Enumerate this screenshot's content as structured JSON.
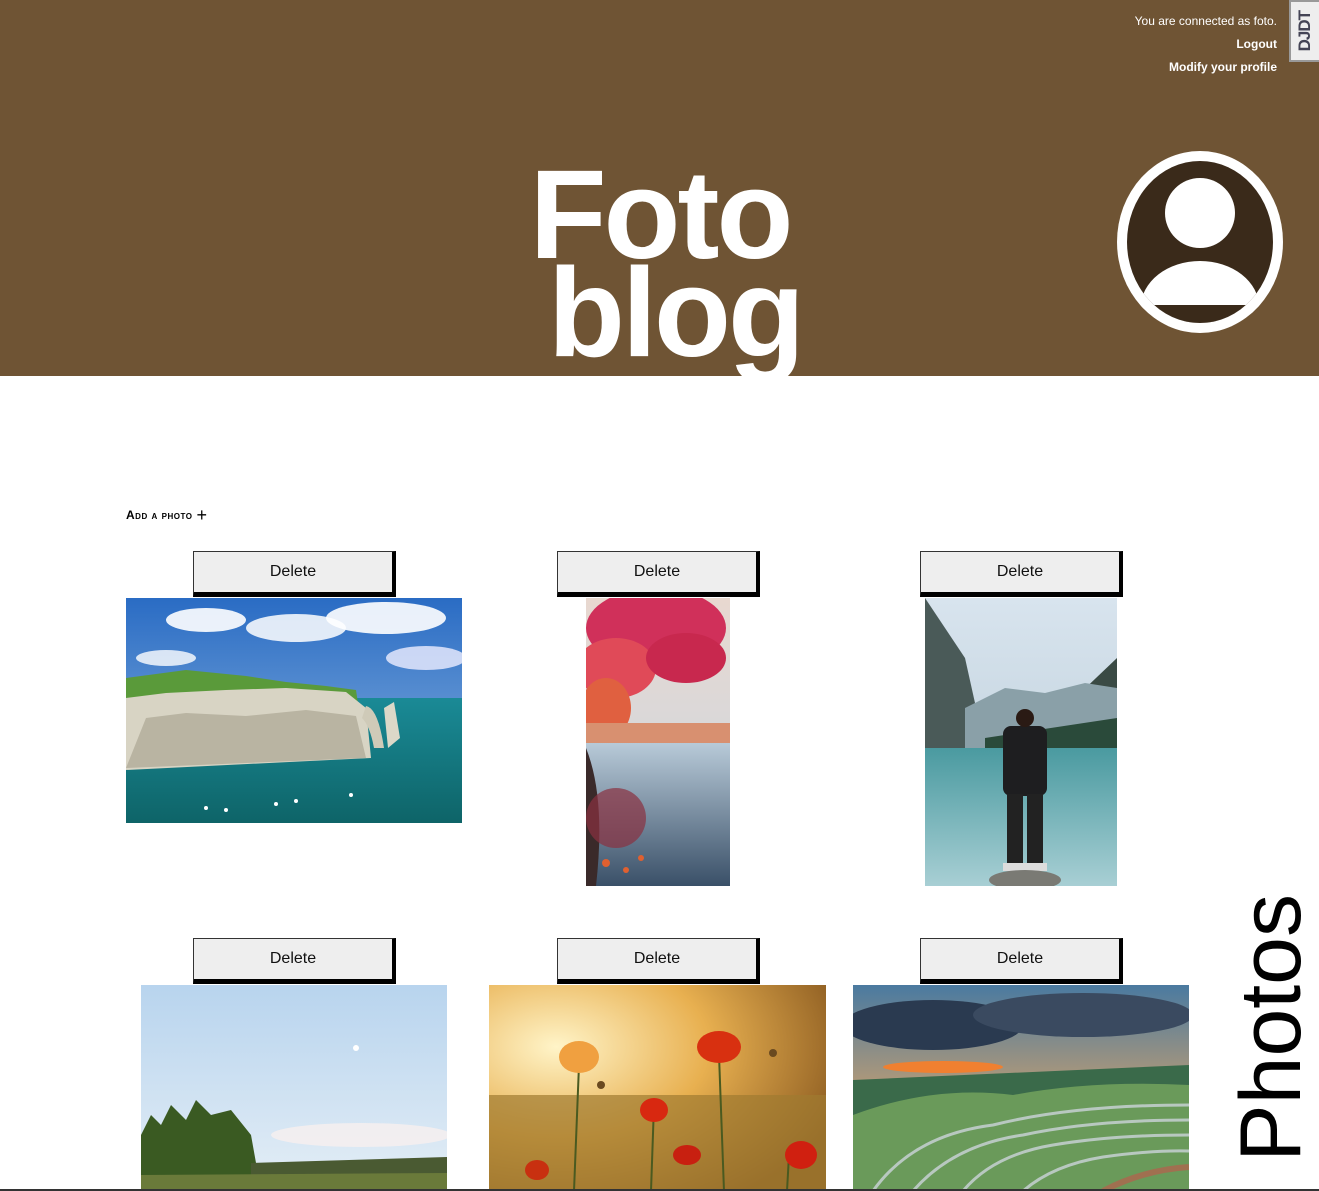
{
  "header": {
    "connected_text": "You are connected as foto.",
    "logout_label": "Logout",
    "modify_label": "Modify your profile",
    "toolbar_label": "DJDT",
    "title_line1": "Foto",
    "title_line2": "blog",
    "avatar_icon": "user-avatar-icon",
    "background_color": "#6f5434"
  },
  "main": {
    "add_label": "Add a photo",
    "add_icon": "plus-icon",
    "delete_label": "Delete",
    "side_label": "Photos",
    "photos": [
      {
        "subject": "sea cliffs with arch under cloudy sky"
      },
      {
        "subject": "red autumn tree over reflecting lake"
      },
      {
        "subject": "man standing before mountain lake"
      },
      {
        "subject": "trees under blue sky"
      },
      {
        "subject": "red poppies in golden field"
      },
      {
        "subject": "rice terraces at sunset"
      }
    ]
  }
}
